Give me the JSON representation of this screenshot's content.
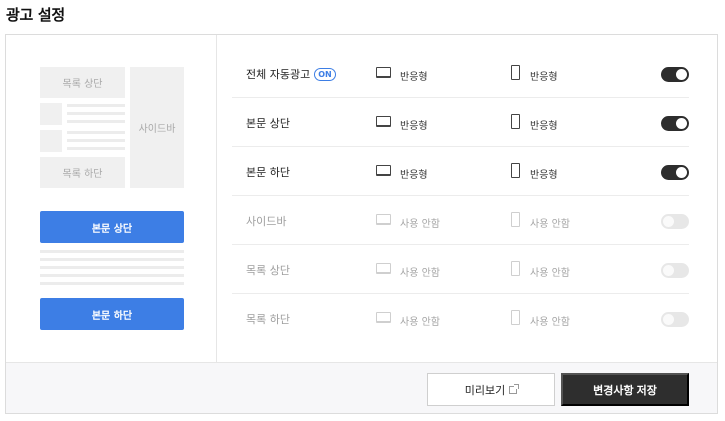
{
  "page": {
    "title": "광고 설정"
  },
  "preview": {
    "list_top": "목록 상단",
    "sidebar": "사이드바",
    "list_bottom": "목록 하단",
    "body_top": "본문 상단",
    "body_bottom": "본문 하단"
  },
  "settings": {
    "rows": [
      {
        "label": "전체 자동광고",
        "badge": "ON",
        "pc_text": "반응형",
        "mobile_text": "반응형",
        "enabled": true
      },
      {
        "label": "본문 상단",
        "pc_text": "반응형",
        "mobile_text": "반응형",
        "enabled": true
      },
      {
        "label": "본문 하단",
        "pc_text": "반응형",
        "mobile_text": "반응형",
        "enabled": true
      },
      {
        "label": "사이드바",
        "pc_text": "사용 안함",
        "mobile_text": "사용 안함",
        "enabled": false
      },
      {
        "label": "목록 상단",
        "pc_text": "사용 안함",
        "mobile_text": "사용 안함",
        "enabled": false
      },
      {
        "label": "목록 하단",
        "pc_text": "사용 안함",
        "mobile_text": "사용 안함",
        "enabled": false
      }
    ]
  },
  "footer": {
    "preview_label": "미리보기",
    "save_label": "변경사항 저장"
  },
  "icons": {
    "pc": "monitor-icon",
    "mobile": "smartphone-icon",
    "external": "external-link-icon"
  },
  "colors": {
    "accent": "#3d7ee5",
    "toggle_on": "#2d2d2d",
    "toggle_off": "#e7e7e7",
    "save_button": "#2e2e2e"
  }
}
